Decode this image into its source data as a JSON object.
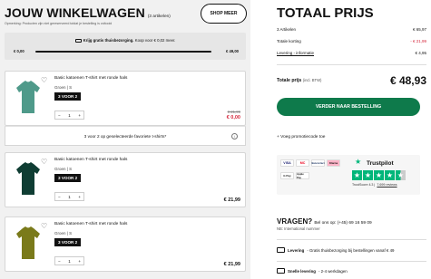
{
  "cart": {
    "title": "JOUW WINKELWAGEN",
    "count": "(3 artikelen)",
    "disclaimer": "Opmerking: Producten zijn niet gereserveerd totdat je bestelling is voltooid",
    "shop_more": "SHOP MEER"
  },
  "shipping": {
    "bold": "Krijg gratis thuisbezorging.",
    "rest": "Koop voor € 0,02 meer.",
    "start": "€ 0,00",
    "end": "€ 49,00",
    "progress": 0.9996
  },
  "items": [
    {
      "name": "Basic katoenen T-shirt met ronde hals",
      "color": "Groen | S",
      "badge": "3 VOOR 2",
      "qty": "1",
      "old_price": "€ 21,99",
      "price": "€ 0,00",
      "shirt_color": "#4f9a8a"
    },
    {
      "name": "Basic katoenen T-shirt met ronde hals",
      "color": "Groen | S",
      "badge": "3 VOOR 2",
      "qty": "1",
      "price": "€ 21,99",
      "shirt_color": "#0f3d33"
    },
    {
      "name": "Basic katoenen T-shirt met ronde hals",
      "color": "Groen | S",
      "badge": "3 VOOR 2",
      "qty": "1",
      "price": "€ 21,99",
      "shirt_color": "#7a7a1a"
    }
  ],
  "promo_note": "3 voor 2 op geselecteerde favoriete t-shirts*",
  "totals": {
    "title": "TOTAAL PRIJS",
    "articles_label": "3 Artikelen",
    "articles_value": "€ 65,97",
    "discount_label": "Totale korting",
    "discount_value": "- € 21,99",
    "delivery_label": "Levering - informatie",
    "delivery_value": "€ 4,95",
    "total_label": "Totale prijs",
    "total_incl": "(incl. BTW)",
    "total_value": "€ 48,93",
    "checkout": "VERDER NAAR BESTELLING",
    "promo_link": "Voeg promotiecode toe"
  },
  "payments": [
    "VISA",
    "MC",
    "Bancontact",
    "Klarna",
    "G Pay",
    "Apple Pay"
  ],
  "trustpilot": {
    "label": "Trustpilot",
    "score": "TrustScore 4.3",
    "reviews": "7.699 reviews"
  },
  "help": {
    "title": "VRAGEN?",
    "call": "Bel ons op: (+45) 69 16 59 09",
    "sub": "NB: International nummer",
    "delivery_bold": "Levering",
    "delivery_text": "- Gratis thuisbezorging bij bestellingen vanaf € 49",
    "fast_bold": "Snelle levering",
    "fast_text": "- 2-4 werkdagen"
  },
  "colors": {
    "accent": "#0e7a4b",
    "discount": "#d5283d",
    "trust": "#00b67a"
  }
}
